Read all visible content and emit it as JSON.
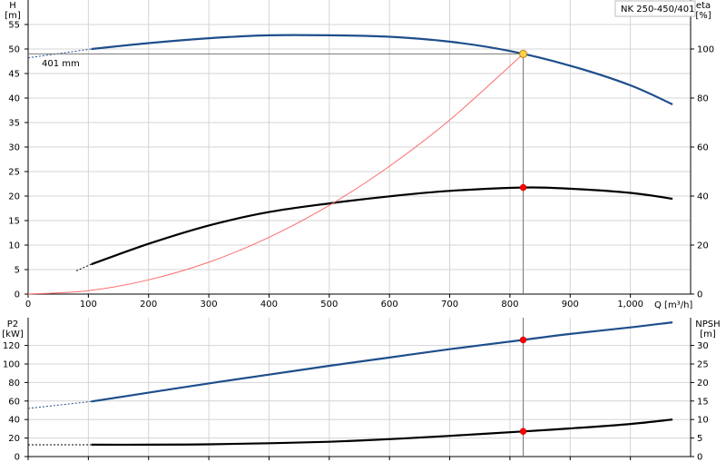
{
  "chart_data": [
    {
      "type": "line",
      "title": "NK 250-450/401",
      "xlabel": "Q [m³/h]",
      "ylabel": "H",
      "ylabel_unit": "[m]",
      "y2label": "eta",
      "y2label_unit": "[%]",
      "xlim": [
        0,
        1100
      ],
      "ylim": [
        0,
        60
      ],
      "y2lim": [
        0,
        120
      ],
      "x_ticks": [
        0,
        100,
        200,
        300,
        400,
        500,
        600,
        700,
        800,
        900,
        1000
      ],
      "x_tick_labels": [
        "0",
        "100",
        "200",
        "300",
        "400",
        "500",
        "600",
        "700",
        "800",
        "900",
        "1,000"
      ],
      "y_ticks": [
        0,
        5,
        10,
        15,
        20,
        25,
        30,
        35,
        40,
        45,
        50,
        55
      ],
      "y2_ticks": [
        0,
        20,
        40,
        60,
        80,
        100
      ],
      "grid": true,
      "annotations": [
        {
          "text": "401 mm"
        }
      ],
      "duty_point": {
        "q": 822,
        "h": 49.0,
        "eta": 43.5
      },
      "series": [
        {
          "id": "head",
          "axis": "y",
          "color": "#1f4e8c",
          "x": [
            105,
            200,
            300,
            400,
            500,
            600,
            700,
            800,
            900,
            1000,
            1070
          ],
          "values": [
            50.0,
            51.2,
            52.2,
            52.8,
            52.8,
            52.5,
            51.5,
            49.6,
            46.6,
            42.6,
            38.7
          ]
        },
        {
          "id": "efficiency",
          "axis": "y2",
          "color": "#000000",
          "x": [
            105,
            200,
            300,
            400,
            500,
            600,
            700,
            822,
            900,
            1000,
            1070
          ],
          "values": [
            12.2,
            20.5,
            28.0,
            33.5,
            37.0,
            39.9,
            42.1,
            43.5,
            43.0,
            41.3,
            38.9
          ]
        },
        {
          "id": "system-curve",
          "axis": "y",
          "color": "#ff6b6b",
          "x": [
            0,
            100,
            200,
            300,
            400,
            500,
            600,
            700,
            822
          ],
          "values": [
            0.0,
            0.7,
            2.9,
            6.5,
            11.6,
            18.1,
            26.1,
            35.5,
            49.0
          ]
        }
      ],
      "extrapolated": [
        {
          "axis": "y",
          "x": [
            0,
            105
          ],
          "values": [
            48.2,
            50.0
          ],
          "color": "#1f4e8c"
        },
        {
          "axis": "y2",
          "x": [
            80,
            105
          ],
          "values": [
            9.5,
            12.2
          ],
          "color": "#000000"
        }
      ]
    },
    {
      "type": "line",
      "xlabel": "",
      "ylabel": "P2",
      "ylabel_unit": "[kW]",
      "y2label": "NPSH",
      "y2label_unit": "[m]",
      "xlim": [
        0,
        1100
      ],
      "ylim": [
        0,
        150
      ],
      "y2lim": [
        0,
        37.5
      ],
      "y_ticks": [
        0,
        20,
        40,
        60,
        80,
        100,
        120
      ],
      "y2_ticks": [
        0,
        5,
        10,
        15,
        20,
        25,
        30
      ],
      "grid": true,
      "series": [
        {
          "id": "power",
          "axis": "y",
          "color": "#1f4e8c",
          "x": [
            105,
            200,
            300,
            400,
            500,
            600,
            700,
            822,
            900,
            1000,
            1070
          ],
          "values": [
            59.5,
            69.0,
            79.0,
            88.5,
            98.0,
            107.0,
            116.0,
            126.0,
            132.5,
            139.5,
            145.0
          ]
        },
        {
          "id": "npsh",
          "axis": "y2",
          "color": "#000000",
          "x": [
            105,
            200,
            300,
            400,
            500,
            600,
            700,
            822,
            900,
            1000,
            1070
          ],
          "values": [
            3.2,
            3.2,
            3.3,
            3.6,
            4.0,
            4.7,
            5.6,
            6.8,
            7.6,
            8.8,
            10.0
          ]
        }
      ],
      "extrapolated": [
        {
          "axis": "y",
          "x": [
            0,
            105
          ],
          "values": [
            52.0,
            59.5
          ],
          "color": "#1f4e8c"
        },
        {
          "axis": "y2",
          "x": [
            0,
            105
          ],
          "values": [
            3.2,
            3.2
          ],
          "color": "#000000"
        }
      ],
      "duty_point": {
        "q": 822,
        "p2": 126.0,
        "npsh": 6.8
      }
    }
  ]
}
